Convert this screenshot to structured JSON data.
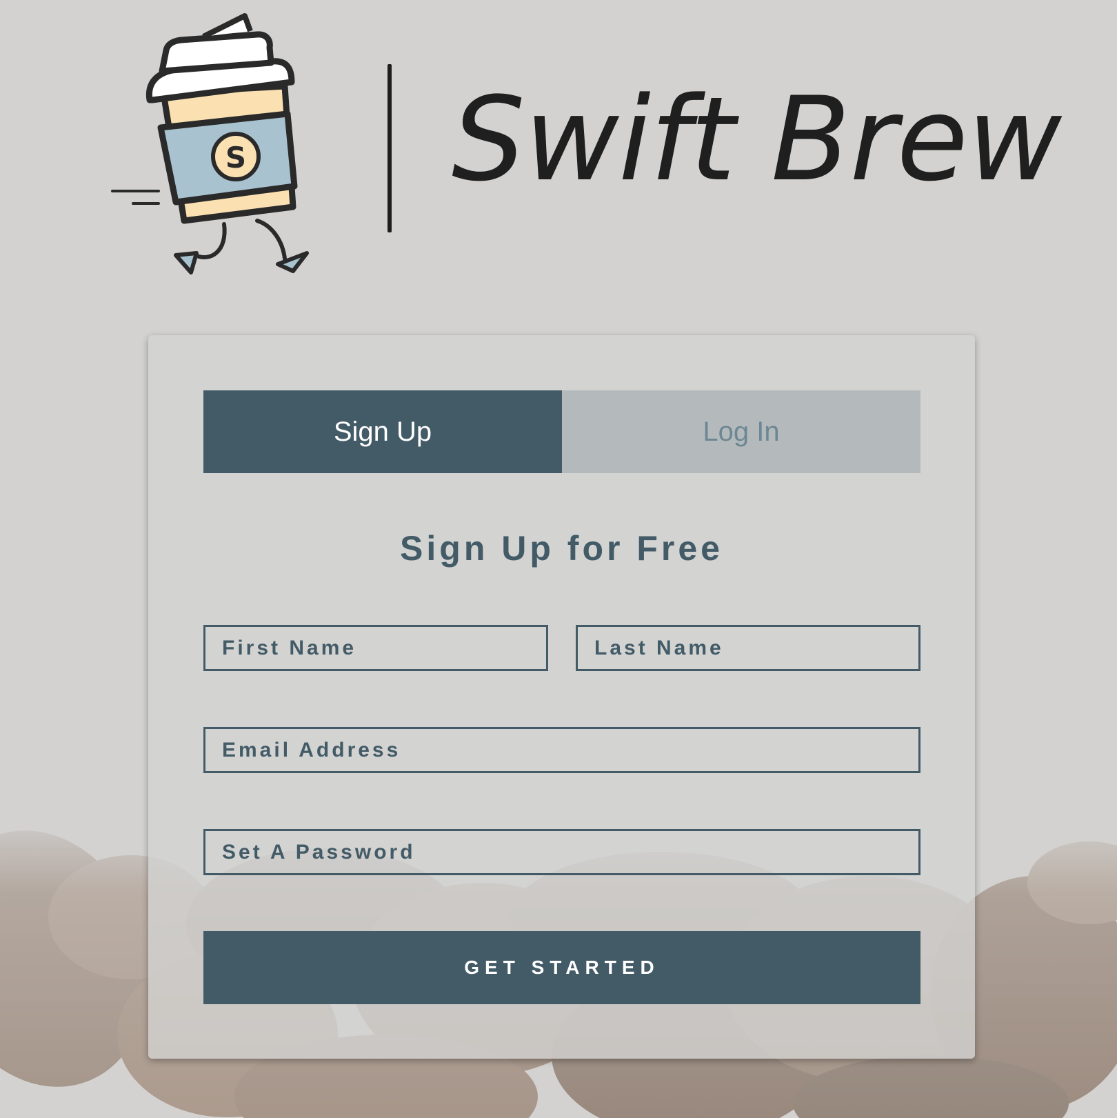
{
  "brand": {
    "name": "Swift Brew"
  },
  "auth": {
    "tabs": [
      {
        "label": "Sign Up",
        "active": true
      },
      {
        "label": "Log In",
        "active": false
      }
    ],
    "heading": "Sign Up for Free",
    "fields": {
      "first_name": "First Name",
      "last_name": "Last Name",
      "email": "Email Address",
      "password": "Set A Password"
    },
    "submit_label": "GET STARTED"
  },
  "colors": {
    "primary": "#435b67",
    "tab_inactive_bg": "#b4babc",
    "tab_inactive_text": "#6d8793",
    "page_bg": "#d3d2d1"
  },
  "icons": {
    "logo": "running-coffee-cup-icon"
  }
}
